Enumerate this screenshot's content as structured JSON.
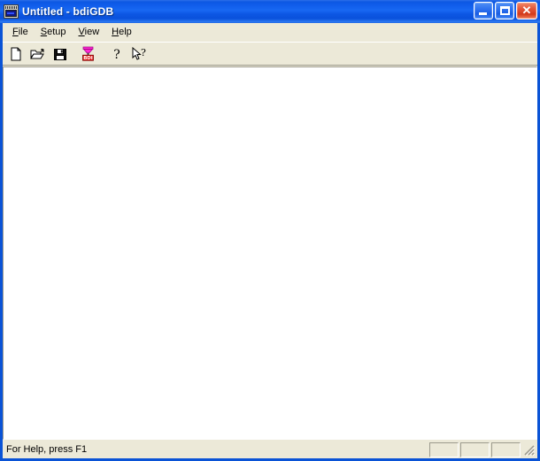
{
  "window": {
    "title": "Untitled - bdiGDB",
    "icon": "bdigdb-app-icon",
    "frame_color": "#0A53D6",
    "titlebar_gradient_from": "#2c70e8",
    "titlebar_gradient_to": "#1e63e0",
    "buttons": {
      "minimize": {
        "label": "_",
        "name": "minimize-button"
      },
      "maximize": {
        "label": "",
        "name": "maximize-button"
      },
      "close": {
        "label": "✕",
        "name": "close-button",
        "color": "#d23a1c"
      }
    }
  },
  "menubar": {
    "items": [
      {
        "label": "File",
        "accel": "F"
      },
      {
        "label": "Setup",
        "accel": "S"
      },
      {
        "label": "View",
        "accel": "V"
      },
      {
        "label": "Help",
        "accel": "H"
      }
    ]
  },
  "toolbar": {
    "buttons": [
      {
        "name": "new-file-button",
        "icon": "new-document-icon",
        "tooltip": "New"
      },
      {
        "name": "open-file-button",
        "icon": "open-folder-icon",
        "tooltip": "Open"
      },
      {
        "name": "save-file-button",
        "icon": "floppy-disk-save-icon",
        "tooltip": "Save"
      },
      {
        "name": "bdi-transfer-button",
        "icon": "bdi-funnel-icon",
        "tooltip": "BDI"
      },
      {
        "name": "about-help-button",
        "icon": "question-mark-icon",
        "tooltip": "About"
      },
      {
        "name": "context-help-button",
        "icon": "arrow-question-icon",
        "tooltip": "Context Help"
      }
    ],
    "bdi_icon_label": "BDI"
  },
  "client": {
    "content": "",
    "background": "#ffffff"
  },
  "statusbar": {
    "message": "For Help, press F1",
    "panes": [
      "",
      "",
      ""
    ],
    "resize_grip": "resize-grip"
  }
}
